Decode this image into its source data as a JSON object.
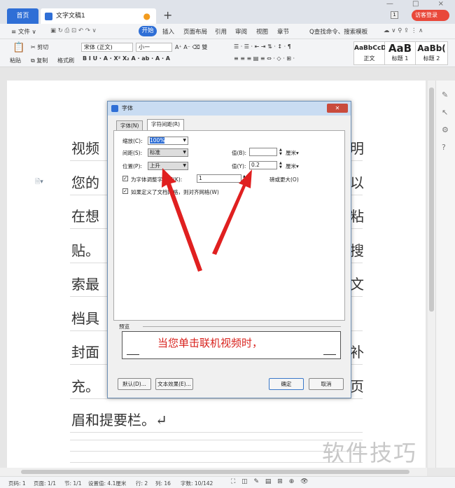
{
  "tabs": {
    "home": "首页",
    "doc": "文字文稿1",
    "new": "+"
  },
  "window": {
    "badge": "1",
    "login": "访客登录",
    "controls": "— □ ×"
  },
  "menu": {
    "file": "≡ 文件 ∨",
    "start": "开始",
    "insert": "插入",
    "layout": "页面布局",
    "ref": "引用",
    "review": "审阅",
    "view": "视图",
    "chapter": "章节",
    "search": "Q查找命令、搜索模板"
  },
  "ribbon": {
    "paste": "粘贴",
    "cut": "剪切",
    "copy": "复制",
    "painter": "格式刷",
    "font": "宋体 (正文)",
    "size": "小一",
    "styles": [
      {
        "sample": "AaBbCcD",
        "name": "正文"
      },
      {
        "sample": "AaB",
        "name": "标题 1"
      },
      {
        "sample": "AaBb(",
        "name": "标题 2"
      }
    ]
  },
  "doc": {
    "lines": [
      {
        "left": "视频",
        "right": "明"
      },
      {
        "left": "您的",
        "right": "以"
      },
      {
        "left": "在想",
        "right": "粘"
      },
      {
        "left": "贴。",
        "right": "搜"
      },
      {
        "left": "索最",
        "right": "文"
      },
      {
        "left": "档具",
        "right": ""
      },
      {
        "left": "封面",
        "right": "补"
      },
      {
        "left": "充。",
        "right": "页"
      },
      {
        "left": "眉和提要栏。↵",
        "right": ""
      }
    ]
  },
  "dialog": {
    "title": "字体",
    "tab1": "字体(N)",
    "tab2": "字符间距(R)",
    "scale_label": "缩放(C):",
    "scale_value": "100%",
    "spacing_label": "间距(S):",
    "spacing_value": "标准",
    "spacing_val_label": "值(B):",
    "spacing_val": "",
    "unit1": "厘米▾",
    "pos_label": "位置(P):",
    "pos_value": "上升",
    "pos_val_label": "值(Y):",
    "pos_val": "0.2",
    "unit2": "厘米▾",
    "kern_label": "为字体调整字间距(K):",
    "kern_val": "1",
    "kern_unit": "磅或更大(O)",
    "grid_label": "如果定义了文档网格，则对齐网格(W)",
    "preview_label": "预览",
    "preview_text": "当您单击联机视频时，",
    "default_btn": "默认(D)...",
    "effect_btn": "文本效果(E)...",
    "ok": "确定",
    "cancel": "取消"
  },
  "status": {
    "page": "页码: 1",
    "pages": "页面: 1/1",
    "section": "节: 1/1",
    "pos": "设置值: 4.1厘米",
    "row": "行: 2",
    "col": "列: 16",
    "words": "字数: 10/142"
  },
  "watermark": "软件技巧",
  "colors": {
    "accent": "#2f6fd6",
    "arrow": "#e02020",
    "preview": "#d8241f"
  }
}
